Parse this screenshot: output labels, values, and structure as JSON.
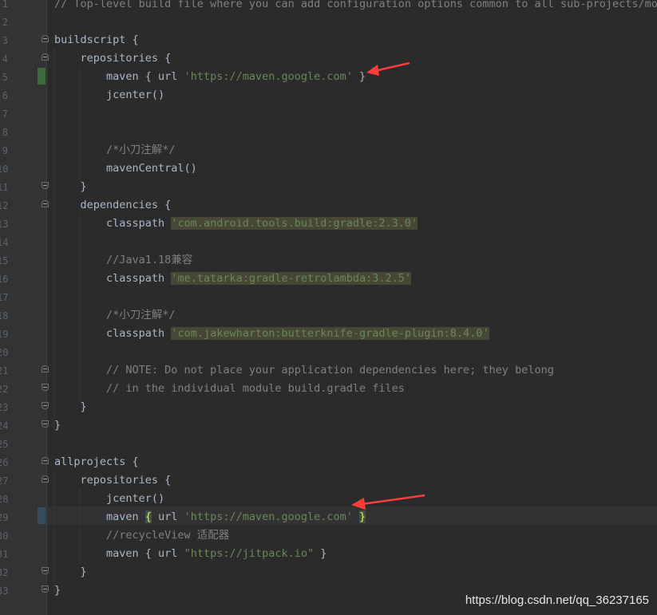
{
  "line_numbers": [
    "1",
    "2",
    "3",
    "4",
    "5",
    "6",
    "7",
    "8",
    "9",
    "10",
    "11",
    "12",
    "13",
    "14",
    "15",
    "16",
    "17",
    "18",
    "19",
    "20",
    "21",
    "22",
    "23",
    "24",
    "25",
    "26",
    "27",
    "28",
    "29",
    "30",
    "31",
    "32",
    "33"
  ],
  "code": {
    "l1": "// Top-level build file where you can add configuration options common to all sub-projects/modu",
    "l3": "buildscript {",
    "l4": "    repositories {",
    "l5_a": "        maven { url ",
    "l5_s": "'https://maven.google.com'",
    "l5_b": " }",
    "l6": "        jcenter()",
    "l9": "        /*小刀注解*/",
    "l10": "        mavenCentral()",
    "l11": "    }",
    "l12": "    dependencies {",
    "l13_a": "        classpath ",
    "l13_s": "'com.android.tools.build:gradle:2.3.0'",
    "l15": "        //Java1.18兼容",
    "l16_a": "        classpath ",
    "l16_s": "'me.tatarka:gradle-retrolambda:3.2.5'",
    "l18": "        /*小刀注解*/",
    "l19_a": "        classpath ",
    "l19_s": "'com.jakewharton:butterknife-gradle-plugin:8.4.0'",
    "l21": "        // NOTE: Do not place your application dependencies here; they belong",
    "l22": "        // in the individual module build.gradle files",
    "l23": "    }",
    "l24": "}",
    "l26": "allprojects {",
    "l27": "    repositories {",
    "l28": "        jcenter()",
    "l29_a": "        maven ",
    "l29_open": "{",
    "l29_b": " url ",
    "l29_s": "'https://maven.google.com'",
    "l29_sp": " ",
    "l29_close": "}",
    "l30": "        //recycleView 适配器",
    "l31_a": "        maven { url ",
    "l31_s": "\"https://jitpack.io\"",
    "l31_b": " }",
    "l32": "    }",
    "l33": "}"
  },
  "watermark": "https://blog.csdn.net/qq_36237165",
  "colors": {
    "background": "#2b2b2b",
    "comment": "#808080",
    "string": "#6a8759",
    "arrow": "#ff3b3b"
  }
}
